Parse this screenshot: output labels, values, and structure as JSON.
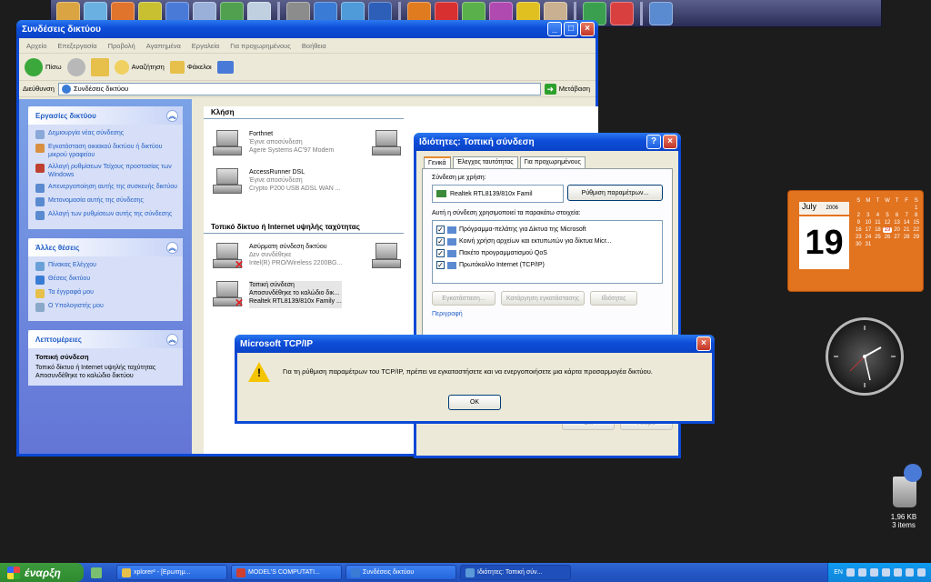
{
  "explorer": {
    "title": "Συνδέσεις δικτύου",
    "menu": [
      "Αρχείο",
      "Επεξεργασία",
      "Προβολή",
      "Αγαπημένα",
      "Εργαλεία",
      "Για προχωρημένους",
      "Βοήθεια"
    ],
    "toolbar": {
      "back": "Πίσω",
      "search": "Αναζήτηση",
      "folders": "Φάκελοι"
    },
    "address": {
      "label": "Διεύθυνση",
      "value": "Συνδέσεις δικτύου",
      "go": "Μετάβαση"
    },
    "taskpane": {
      "network_tasks": {
        "title": "Εργασίες δικτύου",
        "items": [
          "Δημιουργία νέας σύνδεσης",
          "Εγκατάσταση οικιακού δικτύου ή δικτύου μικρού γραφείου",
          "Αλλαγή ρυθμίσεων Τείχους προστασίας των Windows",
          "Απενεργοποίηση αυτής της συσκευής δικτύου",
          "Μετονομασία αυτής της σύνδεσης",
          "Αλλαγή των ρυθμίσεων αυτής της σύνδεσης"
        ]
      },
      "other_places": {
        "title": "Άλλες θέσεις",
        "items": [
          "Πίνακας Ελέγχου",
          "Θέσεις δικτύου",
          "Τα έγγραφά μου",
          "Ο Υπολογιστής μου"
        ]
      },
      "details": {
        "title": "Λεπτομέρειες",
        "name": "Τοπική σύνδεση",
        "line1": "Τοπικό δίκτυο ή Internet υψηλής ταχύτητας",
        "line2": "Αποσυνδέθηκε το καλώδιο δικτύου"
      }
    },
    "content": {
      "group1": "Κλήση",
      "group2": "Τοπικό δίκτυο ή Internet υψηλής ταχύτητας",
      "connections": [
        {
          "name": "Forthnet",
          "status": "Έγινε αποσύνδεση",
          "device": "Agere Systems AC'97 Modem"
        },
        {
          "name": "AccessRunner DSL",
          "status": "Έγινε αποσύνδεση",
          "device": "Crypto P200 USB ADSL WAN ..."
        },
        {
          "name": "Ασύρματη σύνδεση δικτύου",
          "status": "Δεν συνδέθηκε",
          "device": "Intel(R) PRO/Wireless 2200BG..."
        },
        {
          "name": "Τοπική σύνδεση",
          "status": "Αποσυνδέθηκε το καλώδιο δικ...",
          "device": "Realtek RTL8139/810x Family ..."
        }
      ]
    }
  },
  "props": {
    "title": "Ιδιότητες: Τοπική σύνδεση",
    "tabs": [
      "Γενικά",
      "Έλεγχος ταυτότητας",
      "Για προχωρημένους"
    ],
    "connect_using_label": "Σύνδεση με χρήση:",
    "adapter": "Realtek RTL8139/810x Famil",
    "configure_button": "Ρύθμιση παραμέτρων...",
    "items_label": "Αυτή η σύνδεση χρησιμοποιεί τα παρακάτω στοιχεία:",
    "items": [
      "Πρόγραμμα-πελάτης για Δίκτυα της Microsoft",
      "Κοινή χρήση αρχείων και εκτυπωτών για δίκτυα Micr...",
      "Πακέτο προγραμματισμού QoS",
      "Πρωτόκολλο Internet (TCP/IP)"
    ],
    "install_button": "Εγκατάσταση...",
    "uninstall_button": "Κατάργηση εγκατάστασης",
    "properties_button": "Ιδιότητες",
    "description_label": "Περιγραφή",
    "ok_button": "OK",
    "cancel_button": "Άκυρο"
  },
  "msgbox": {
    "title": "Microsoft TCP/IP",
    "message": "Για τη ρύθμιση παραμέτρων του TCP/IP, πρέπει να εγκαταστήσετε και να ενεργοποιήσετε μια κάρτα προσαρμογέα δικτύου.",
    "ok": "OK"
  },
  "calendar": {
    "month": "July",
    "year": "2006",
    "day": "19",
    "weekdays": [
      "S",
      "M",
      "T",
      "W",
      "T",
      "F",
      "S"
    ],
    "days": [
      "",
      "",
      "",
      "",
      "",
      "",
      "1",
      "2",
      "3",
      "4",
      "5",
      "6",
      "7",
      "8",
      "9",
      "10",
      "11",
      "12",
      "13",
      "14",
      "15",
      "16",
      "17",
      "18",
      "19",
      "20",
      "21",
      "22",
      "23",
      "24",
      "25",
      "26",
      "27",
      "28",
      "29",
      "30",
      "31"
    ],
    "today": "19"
  },
  "recycle": {
    "size": "1,96 KB",
    "count": "3 items"
  },
  "taskbar": {
    "start": "έναρξη",
    "tasks": [
      "xplorer² - [Ερωτημ...",
      "MODEL'S COMPUTATI...",
      "Συνδέσεις δικτύου",
      "Ιδιότητες: Τοπική σύν..."
    ],
    "lang": "EN"
  },
  "colors": {
    "xp_blue": "#0b49d6",
    "start_green": "#2f8a2f",
    "calendar_orange": "#e2731f"
  }
}
